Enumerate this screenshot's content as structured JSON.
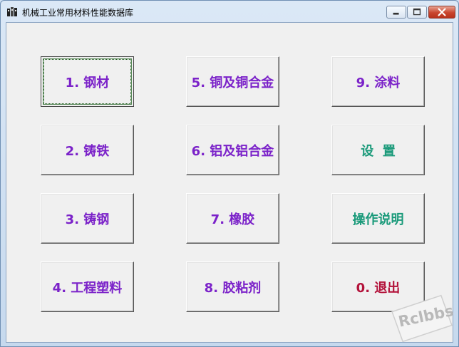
{
  "window": {
    "title": "机械工业常用材料性能数据库"
  },
  "buttons": [
    {
      "label": "1. 钢材",
      "color": "#7b22c9"
    },
    {
      "label": "5. 铜及铜合金",
      "color": "#7b22c9"
    },
    {
      "label": "9. 涂料",
      "color": "#7b22c9"
    },
    {
      "label": "2. 铸铁",
      "color": "#7b22c9"
    },
    {
      "label": "6. 铝及铝合金",
      "color": "#7b22c9"
    },
    {
      "label": "设  置",
      "color": "#1a9a7a"
    },
    {
      "label": "3. 铸钢",
      "color": "#7b22c9"
    },
    {
      "label": "7. 橡胶",
      "color": "#7b22c9"
    },
    {
      "label": "操作说明",
      "color": "#1a9a7a"
    },
    {
      "label": "4. 工程塑料",
      "color": "#7b22c9"
    },
    {
      "label": "8. 胶粘剂",
      "color": "#7b22c9"
    },
    {
      "label": "0. 退出",
      "color": "#b3123a"
    }
  ],
  "watermark": {
    "text": "Rclbbs"
  }
}
